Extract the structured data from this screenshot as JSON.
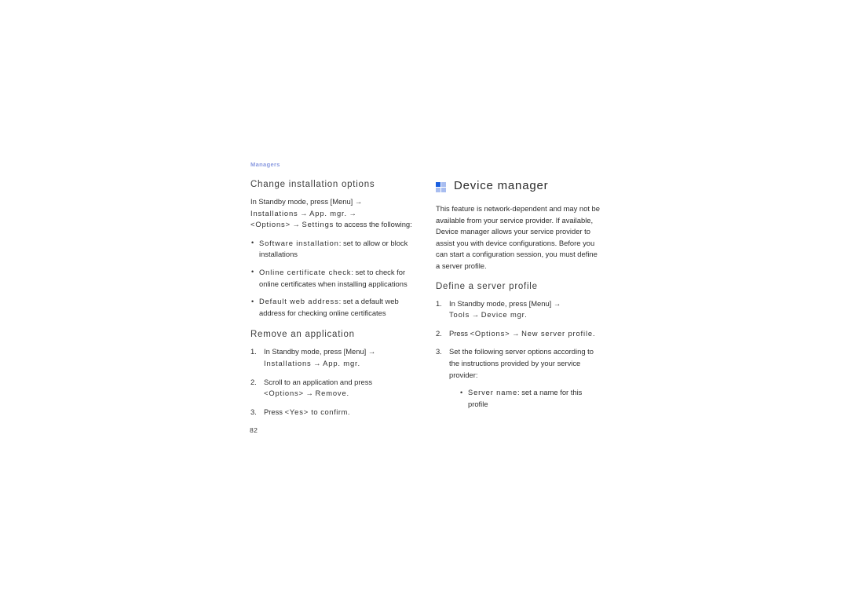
{
  "page": {
    "running_head": "Managers",
    "folio": "82",
    "accent_color": "#8a9ae0",
    "icon_color_dark": "#1a5fe0",
    "icon_color_light": "#a8bdf0"
  },
  "left_column": {
    "section1": {
      "heading": "Change installation options",
      "intro_line1_a": "In Standby mode, press [Menu] ",
      "intro_line1_arrow": "→",
      "intro_line2_a": "Installations",
      "intro_line2_arrow1": "→",
      "intro_line2_b": "App. mgr.",
      "intro_line2_arrow2": "→",
      "intro_line3_a": "<Options>",
      "intro_line3_arrow": "→",
      "intro_line3_b": "Settings",
      "intro_line3_c": " to access the following:",
      "bullets": [
        {
          "term": "Software installation",
          "text": ": set to allow or block installations"
        },
        {
          "term": "Online certificate check",
          "text": ": set to check for online certificates when installing applications"
        },
        {
          "term": "Default web address",
          "text": ": set a default web address for checking online certificates"
        }
      ]
    },
    "section2": {
      "heading": "Remove an application",
      "steps": [
        {
          "text_a": "In Standby mode, press [Menu] ",
          "arrow1": "→",
          "term1": "Installations",
          "arrow2": "→",
          "term2": "App. mgr.",
          "text_b": ""
        },
        {
          "text_a": "Scroll to an application and press ",
          "term1": "<Options>",
          "arrow1": "→",
          "term2": "Remove.",
          "text_b": ""
        },
        {
          "text_a": "Press ",
          "term1": "<Yes>",
          "text_b": " to confirm."
        }
      ]
    }
  },
  "right_column": {
    "chapter_title": "Device manager",
    "intro": "This feature is network-dependent and may not be available from your service provider. If available, Device manager allows your service provider to assist you with device configurations. Before you can start a configuration session, you must define a server profile.",
    "section1": {
      "heading": "Define a server profile",
      "steps": [
        {
          "text_a": "In Standby mode, press [Menu] ",
          "arrow1": "→",
          "term1": "Tools",
          "arrow2": "→",
          "term2": "Device mgr.",
          "text_b": ""
        },
        {
          "text_a": "Press ",
          "term1": "<Options>",
          "arrow1": "→",
          "term2": "New server profile.",
          "text_b": ""
        },
        {
          "text_a": "Set the following server options according to the instructions provided by your service provider:",
          "term1": "",
          "text_b": ""
        }
      ],
      "sub_bullets": [
        {
          "term": "Server name",
          "text": ": set a name for this profile"
        }
      ]
    }
  }
}
